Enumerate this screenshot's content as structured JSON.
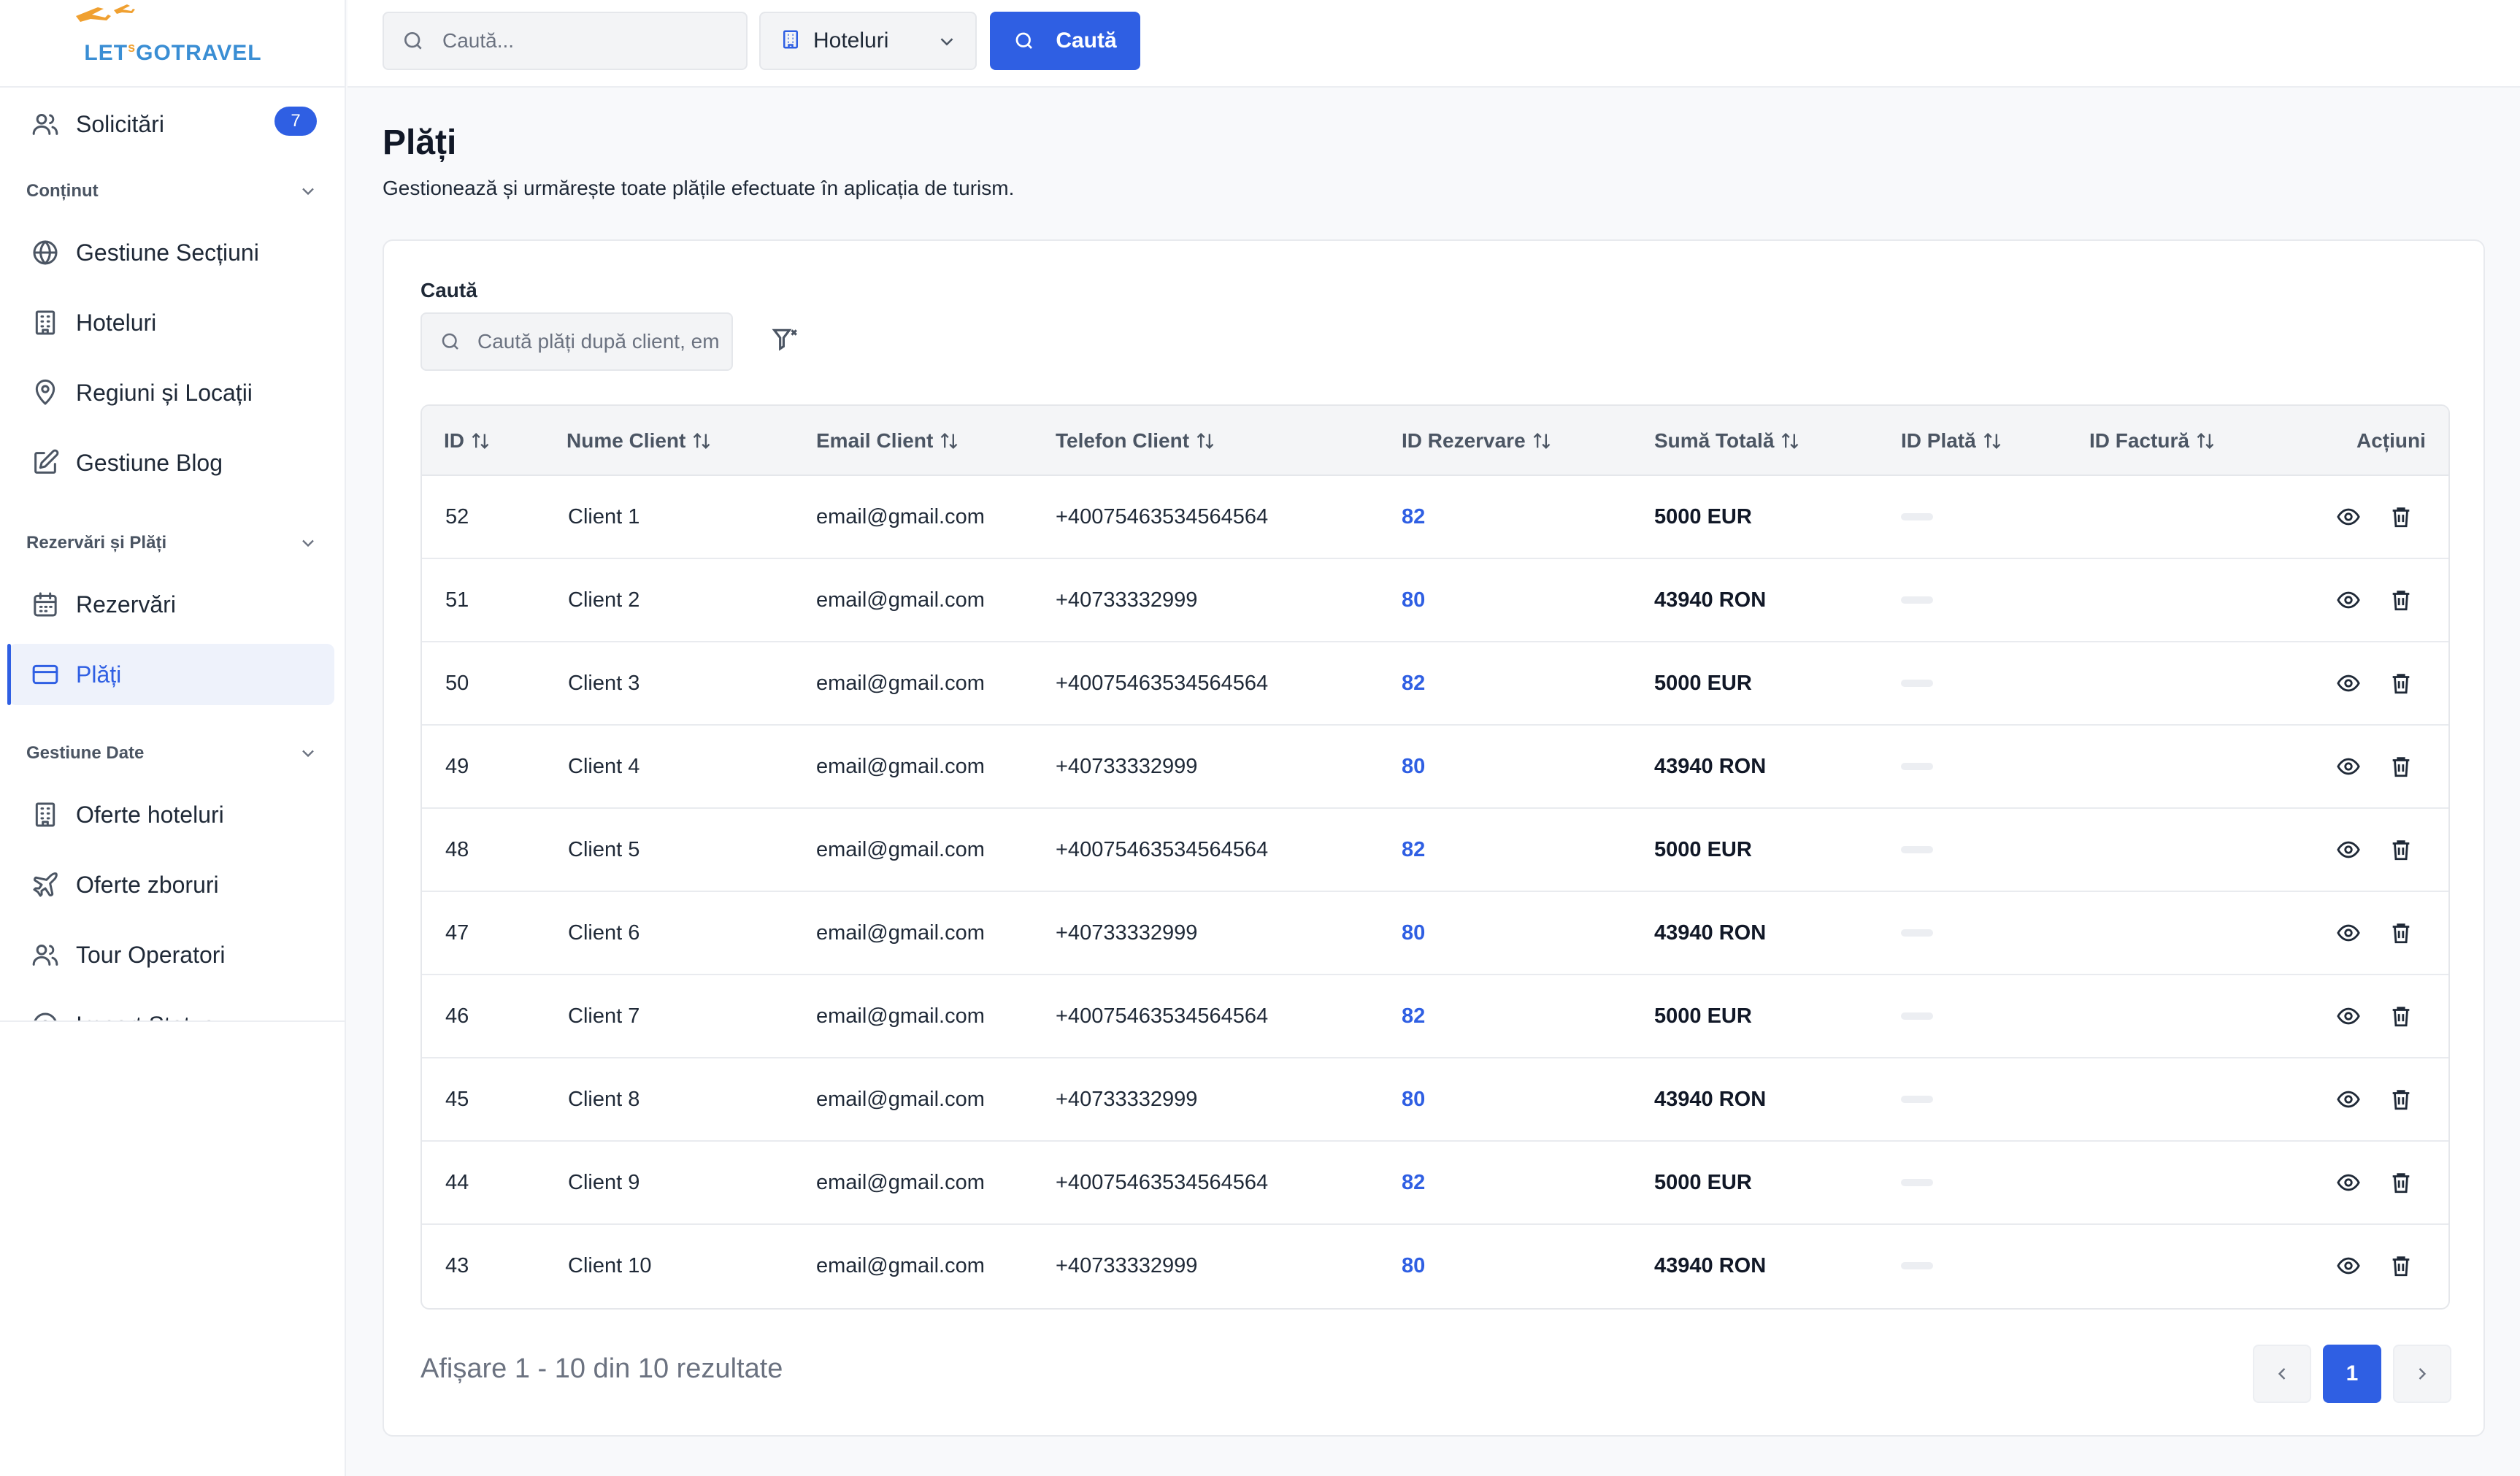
{
  "brand": {
    "logo_main": "LET'S",
    "logo_s": "s",
    "logo_rest": "GOTRAVEL"
  },
  "sidebar": {
    "solicitari": {
      "label": "Solicitări",
      "badge": "7"
    },
    "group_continut": "Conținut",
    "gestiune_sectiuni": "Gestiune Secțiuni",
    "hoteluri": "Hoteluri",
    "regiuni": "Regiuni și Locații",
    "blog": "Gestiune Blog",
    "group_rezervari": "Rezervări și Plăți",
    "rezervari": "Rezervări",
    "plati": "Plăți",
    "group_date": "Gestiune Date",
    "oferte_hoteluri": "Oferte hoteluri",
    "oferte_zboruri": "Oferte zboruri",
    "tour_operatori": "Tour Operatori",
    "import_status": "Import Status"
  },
  "topbar": {
    "search_placeholder": "Caută...",
    "select_value": "Hoteluri",
    "search_button": "Caută"
  },
  "page": {
    "title": "Plăți",
    "subtitle": "Gestionează și urmărește toate plățile efectuate în aplicația de turism."
  },
  "filter": {
    "label": "Caută",
    "placeholder": "Caută plăți după client, email..."
  },
  "table": {
    "headers": {
      "id": "ID",
      "nume": "Nume Client",
      "email": "Email Client",
      "telefon": "Telefon Client",
      "rezervare": "ID Rezervare",
      "suma": "Sumă Totală",
      "plata": "ID Plată",
      "factura": "ID Factură",
      "actiuni": "Acțiuni"
    },
    "rows": [
      {
        "id": "52",
        "nume": "Client 1",
        "email": "email@gmail.com",
        "telefon": "+40075463534564564",
        "rezervare": "82",
        "suma": "5000 EUR"
      },
      {
        "id": "51",
        "nume": "Client 2",
        "email": "email@gmail.com",
        "telefon": "+40733332999",
        "rezervare": "80",
        "suma": "43940 RON"
      },
      {
        "id": "50",
        "nume": "Client 3",
        "email": "email@gmail.com",
        "telefon": "+40075463534564564",
        "rezervare": "82",
        "suma": "5000 EUR"
      },
      {
        "id": "49",
        "nume": "Client 4",
        "email": "email@gmail.com",
        "telefon": "+40733332999",
        "rezervare": "80",
        "suma": "43940 RON"
      },
      {
        "id": "48",
        "nume": "Client 5",
        "email": "email@gmail.com",
        "telefon": "+40075463534564564",
        "rezervare": "82",
        "suma": "5000 EUR"
      },
      {
        "id": "47",
        "nume": "Client 6",
        "email": "email@gmail.com",
        "telefon": "+40733332999",
        "rezervare": "80",
        "suma": "43940 RON"
      },
      {
        "id": "46",
        "nume": "Client 7",
        "email": "email@gmail.com",
        "telefon": "+40075463534564564",
        "rezervare": "82",
        "suma": "5000 EUR"
      },
      {
        "id": "45",
        "nume": "Client 8",
        "email": "email@gmail.com",
        "telefon": "+40733332999",
        "rezervare": "80",
        "suma": "43940 RON"
      },
      {
        "id": "44",
        "nume": "Client 9",
        "email": "email@gmail.com",
        "telefon": "+40075463534564564",
        "rezervare": "82",
        "suma": "5000 EUR"
      },
      {
        "id": "43",
        "nume": "Client 10",
        "email": "email@gmail.com",
        "telefon": "+40733332999",
        "rezervare": "80",
        "suma": "43940 RON"
      }
    ]
  },
  "pagination": {
    "info": "Afișare 1 - 10 din 10 rezultate",
    "current": "1"
  },
  "colors": {
    "accent": "#2f5fe3",
    "brand_blue": "#3a8ed4",
    "brand_orange": "#f0a030"
  }
}
